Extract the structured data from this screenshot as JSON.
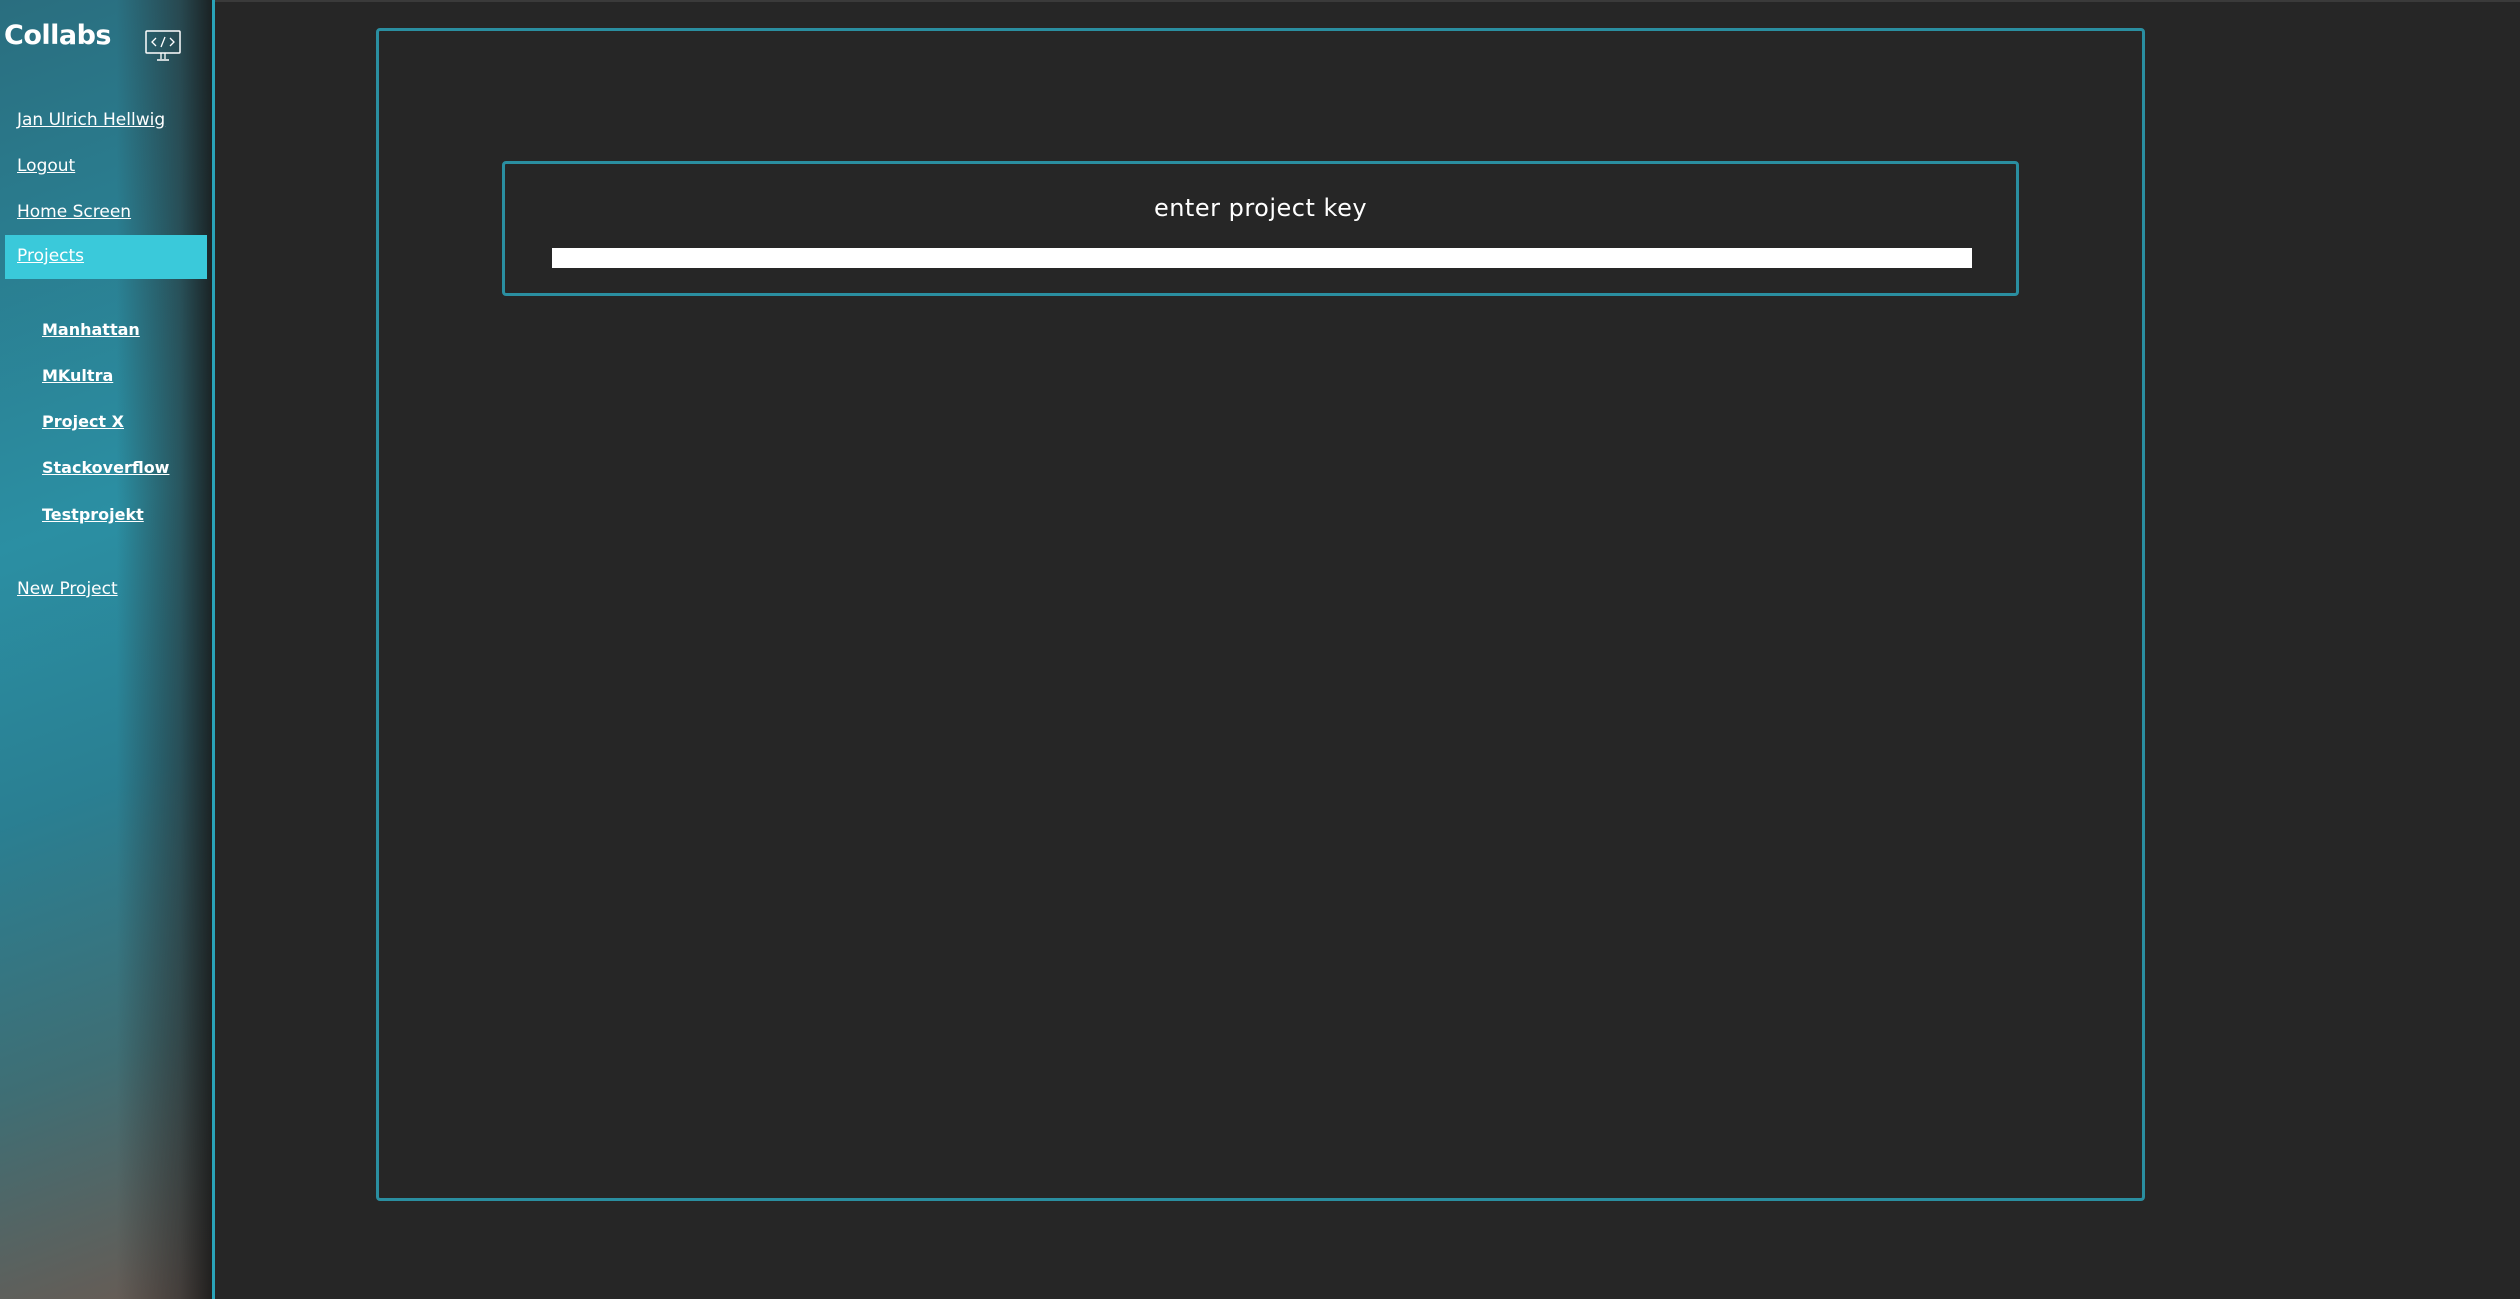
{
  "sidebar": {
    "brand": "Collabs",
    "brand_icon": "code-monitor-icon",
    "user_link": "Jan Ulrich Hellwig",
    "logout_link": "Logout",
    "home_link": "Home Screen",
    "projects_link": "Projects",
    "projects": [
      {
        "label": "Manhattan"
      },
      {
        "label": "MKultra"
      },
      {
        "label": "Project X"
      },
      {
        "label": "Stackoverflow"
      },
      {
        "label": "Testprojekt"
      }
    ],
    "new_project_link": "New Project"
  },
  "main": {
    "key_box": {
      "title": "enter project key",
      "input_value": "",
      "input_placeholder": ""
    }
  },
  "colors": {
    "accent": "#3ac9da",
    "frame_border": "#2a8ea0",
    "background": "#262626"
  }
}
